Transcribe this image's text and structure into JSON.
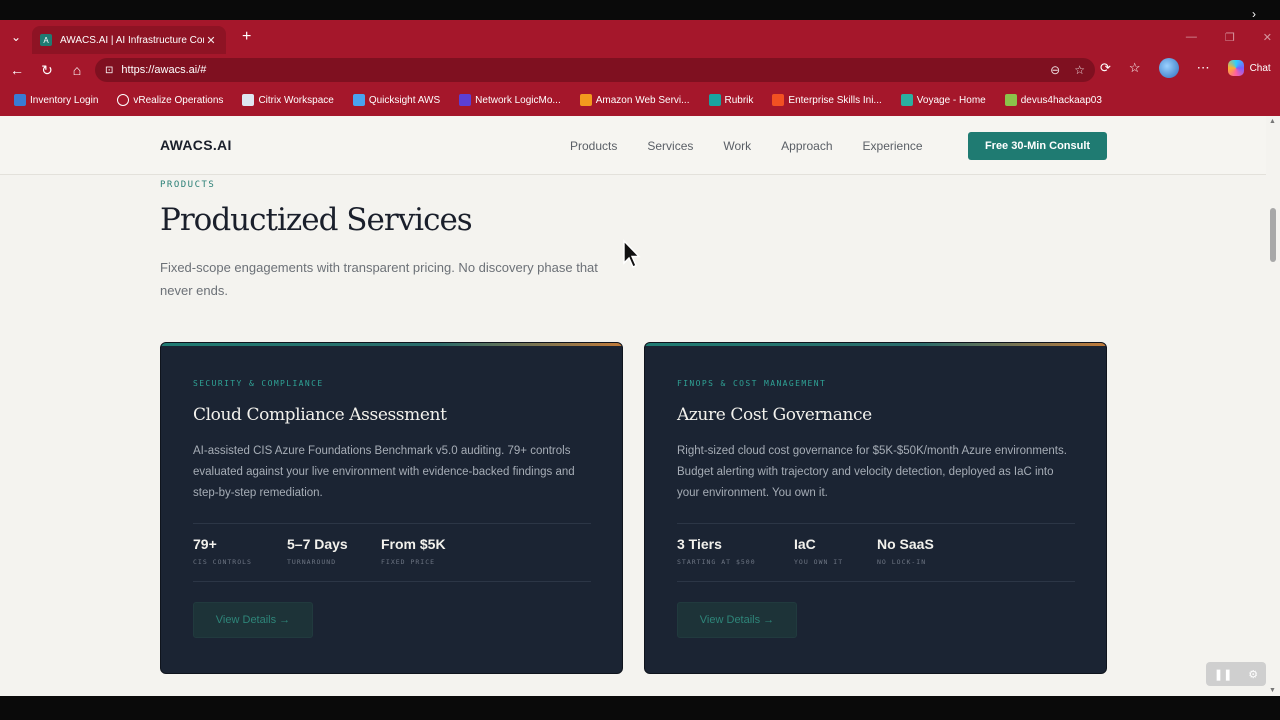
{
  "browser": {
    "tab_title": "AWACS.AI | AI Infrastructure Consu",
    "tab_favicon_letter": "A",
    "url": "https://awacs.ai/#",
    "chat_label": "Chat",
    "bookmarks": [
      {
        "label": "Inventory Login",
        "icon": "inventory-icon",
        "color": "#3a7bd5"
      },
      {
        "label": "vRealize Operations",
        "icon": "globe-icon",
        "color": "#ffffff"
      },
      {
        "label": "Citrix Workspace",
        "icon": "citrix-icon",
        "color": "#dfe7f1"
      },
      {
        "label": "Quicksight AWS",
        "icon": "chart-icon",
        "color": "#4aa3f0"
      },
      {
        "label": "Network LogicMo...",
        "icon": "logicmonitor-icon",
        "color": "#5b3fd6"
      },
      {
        "label": "Amazon Web Servi...",
        "icon": "aws-icon",
        "color": "#f39a1e"
      },
      {
        "label": "Rubrik",
        "icon": "rubrik-icon",
        "color": "#1aa3a0"
      },
      {
        "label": "Enterprise Skills Ini...",
        "icon": "microsoft-icon",
        "color": "#f25022"
      },
      {
        "label": "Voyage - Home",
        "icon": "voyage-icon",
        "color": "#2bb0a0"
      },
      {
        "label": "devus4hackaap03",
        "icon": "puzzle-icon",
        "color": "#8bc34a"
      }
    ]
  },
  "site": {
    "logo": "AWACS.AI",
    "nav": [
      "Products",
      "Services",
      "Work",
      "Approach",
      "Experience"
    ],
    "cta": "Free 30-Min Consult",
    "eyebrow": "PRODUCTS",
    "heading": "Productized Services",
    "lead": "Fixed-scope engagements with transparent pricing. No discovery phase that never ends.",
    "accent": "#1f7b72"
  },
  "cards": [
    {
      "category": "SECURITY & COMPLIANCE",
      "title": "Cloud Compliance Assessment",
      "description": "AI-assisted CIS Azure Foundations Benchmark v5.0 auditing. 79+ controls evaluated against your live environment with evidence-backed findings and step-by-step remediation.",
      "stats": [
        {
          "value": "79+",
          "label": "CIS CONTROLS"
        },
        {
          "value": "5–7 Days",
          "label": "TURNAROUND"
        },
        {
          "value": "From $5K",
          "label": "FIXED PRICE"
        }
      ],
      "button": "View Details →"
    },
    {
      "category": "FINOPS & COST MANAGEMENT",
      "title": "Azure Cost Governance",
      "description": "Right-sized cloud cost governance for $5K-$50K/month Azure environments. Budget alerting with trajectory and velocity detection, deployed as IaC into your environment. You own it.",
      "stats": [
        {
          "value": "3 Tiers",
          "label": "STARTING AT $500"
        },
        {
          "value": "IaC",
          "label": "YOU OWN IT"
        },
        {
          "value": "No SaaS",
          "label": "NO LOCK-IN"
        }
      ],
      "button": "View Details →"
    }
  ]
}
